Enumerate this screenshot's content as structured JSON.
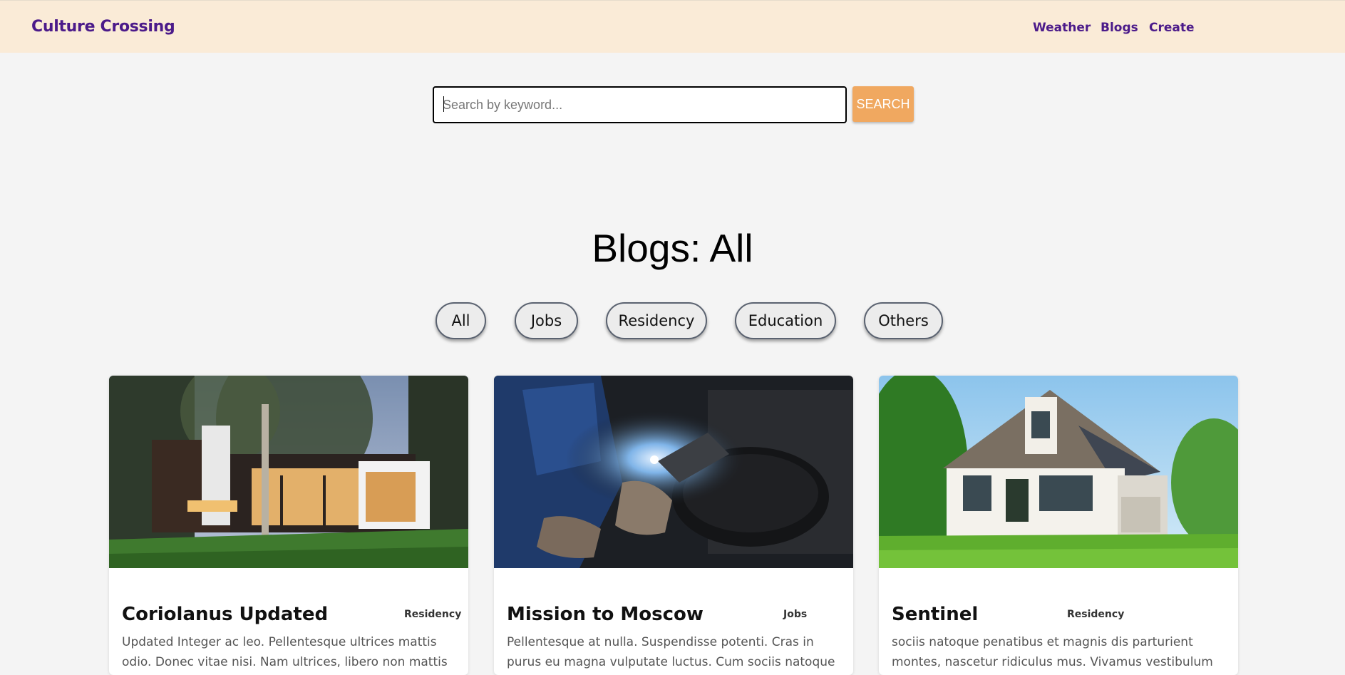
{
  "navbar": {
    "brand": "Culture Crossing",
    "links": [
      "Weather",
      "Blogs",
      "Create"
    ]
  },
  "search": {
    "placeholder": "Search by keyword...",
    "value": "",
    "button_label": "SEARCH"
  },
  "page_title": "Blogs: All",
  "filters": [
    "All",
    "Jobs",
    "Residency",
    "Education",
    "Others"
  ],
  "cards": [
    {
      "image": "modern-house-photo",
      "title": "Coriolanus Updated",
      "category": "Residency",
      "excerpt": "Updated Integer ac leo. Pellentesque ultrices mattis odio. Donec vitae nisi. Nam ultrices, libero non mattis pulvinar."
    },
    {
      "image": "welder-photo",
      "title": "Mission to Moscow",
      "category": "Jobs",
      "excerpt": "Pellentesque at nulla. Suspendisse potenti. Cras in purus eu magna vulputate luctus. Cum sociis natoque penatibus"
    },
    {
      "image": "white-house-photo",
      "title": "Sentinel",
      "category": "Residency",
      "excerpt": "sociis natoque penatibus et magnis dis parturient montes, nascetur ridiculus mus. Vivamus vestibulum sagittis sapien."
    }
  ]
}
